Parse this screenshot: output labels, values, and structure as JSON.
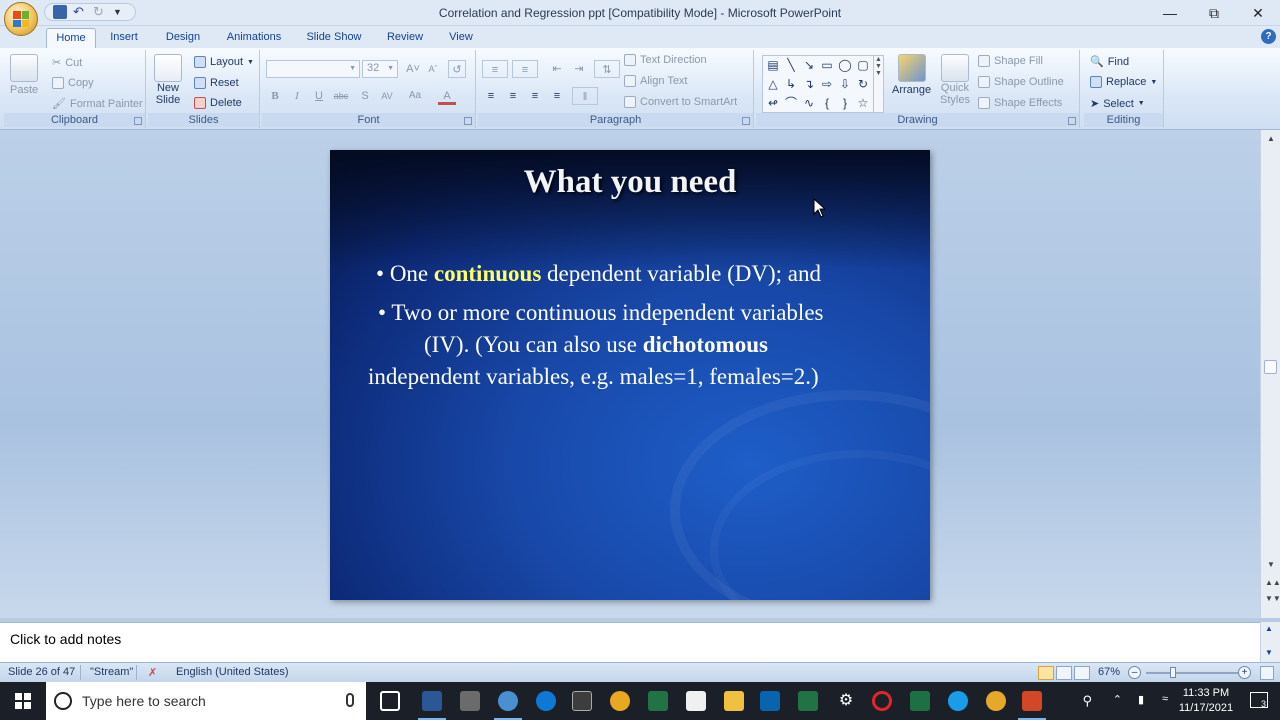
{
  "window": {
    "title": "Correlation and Regression ppt [Compatibility Mode] - Microsoft PowerPoint"
  },
  "tabs": [
    "Home",
    "Insert",
    "Design",
    "Animations",
    "Slide Show",
    "Review",
    "View"
  ],
  "ribbon": {
    "clipboard": {
      "label": "Clipboard",
      "paste": "Paste",
      "cut": "Cut",
      "copy": "Copy",
      "format_painter": "Format Painter"
    },
    "slides": {
      "label": "Slides",
      "new_slide_1": "New",
      "new_slide_2": "Slide",
      "layout": "Layout",
      "reset": "Reset",
      "delete": "Delete"
    },
    "font": {
      "label": "Font",
      "font_name": "",
      "font_size": "32"
    },
    "paragraph": {
      "label": "Paragraph",
      "text_direction": "Text Direction",
      "align_text": "Align Text",
      "convert_smartart": "Convert to SmartArt"
    },
    "drawing": {
      "label": "Drawing",
      "arrange": "Arrange",
      "quick_styles_1": "Quick",
      "quick_styles_2": "Styles",
      "shape_fill": "Shape Fill",
      "shape_outline": "Shape Outline",
      "shape_effects": "Shape Effects"
    },
    "editing": {
      "label": "Editing",
      "find": "Find",
      "replace": "Replace",
      "select": "Select"
    }
  },
  "slide": {
    "title": "What you need",
    "bullet1": {
      "pre": "One ",
      "highlight": "continuous",
      "post": " dependent variable (DV); and"
    },
    "bullet2": {
      "line1": "Two or more continuous independent variables",
      "line2_pre": "(IV). (You can also use ",
      "line2_bold": "dichotomous",
      "line3": "independent variables, e.g. males=1, females=2.)"
    }
  },
  "notes": {
    "placeholder": "Click to add notes"
  },
  "status": {
    "slide_info": "Slide 26 of 47",
    "theme": "\"Stream\"",
    "language": "English (United States)",
    "zoom": "67%"
  },
  "taskbar": {
    "search_placeholder": "Type here to search",
    "time": "11:33 PM",
    "date": "11/17/2021",
    "notification_count": "3"
  }
}
